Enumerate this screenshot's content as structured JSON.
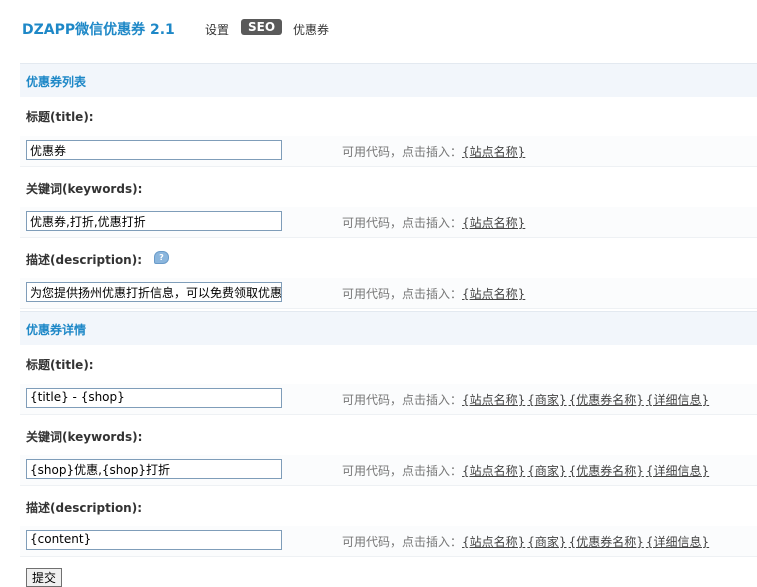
{
  "app": {
    "title": "DZAPP微信优惠券 2.1"
  },
  "nav": {
    "items": [
      {
        "label": "设置",
        "active": false
      },
      {
        "label": "SEO",
        "active": true
      },
      {
        "label": "优惠券",
        "active": false
      }
    ]
  },
  "sections": [
    {
      "title": "优惠券列表",
      "fields": [
        {
          "label": "标题(title):",
          "value": "优惠券",
          "hint_prefix": "可用代码，点击插入：",
          "codes": [
            "{站点名称}"
          ]
        },
        {
          "label": "关键词(keywords):",
          "value": "优惠券,打折,优惠打折",
          "hint_prefix": "可用代码，点击插入：",
          "codes": [
            "{站点名称}"
          ]
        },
        {
          "label": "描述(description):",
          "value": "为您提供扬州优惠打折信息，可以免费领取优惠:",
          "hint_prefix": "可用代码，点击插入：",
          "codes": [
            "{站点名称}"
          ]
        }
      ]
    },
    {
      "title": "优惠券详情",
      "fields": [
        {
          "label": "标题(title):",
          "value": "{title} - {shop}",
          "hint_prefix": "可用代码，点击插入：",
          "codes": [
            "{站点名称}",
            "{商家}",
            "{优惠券名称}",
            "{详细信息}"
          ]
        },
        {
          "label": "关键词(keywords):",
          "value": "{shop}优惠,{shop}打折",
          "hint_prefix": "可用代码，点击插入：",
          "codes": [
            "{站点名称}",
            "{商家}",
            "{优惠券名称}",
            "{详细信息}"
          ]
        },
        {
          "label": "描述(description):",
          "value": "{content}",
          "hint_prefix": "可用代码，点击插入：",
          "codes": [
            "{站点名称}",
            "{商家}",
            "{优惠券名称}",
            "{详细信息}"
          ]
        }
      ]
    }
  ],
  "submit": {
    "label": "提交"
  },
  "icons": {
    "help": "speech-bubble-help-icon"
  },
  "colors": {
    "accent": "#1e88c7",
    "active_tab_bg": "#5a5a5a",
    "section_bg": "#f2f6fb"
  }
}
